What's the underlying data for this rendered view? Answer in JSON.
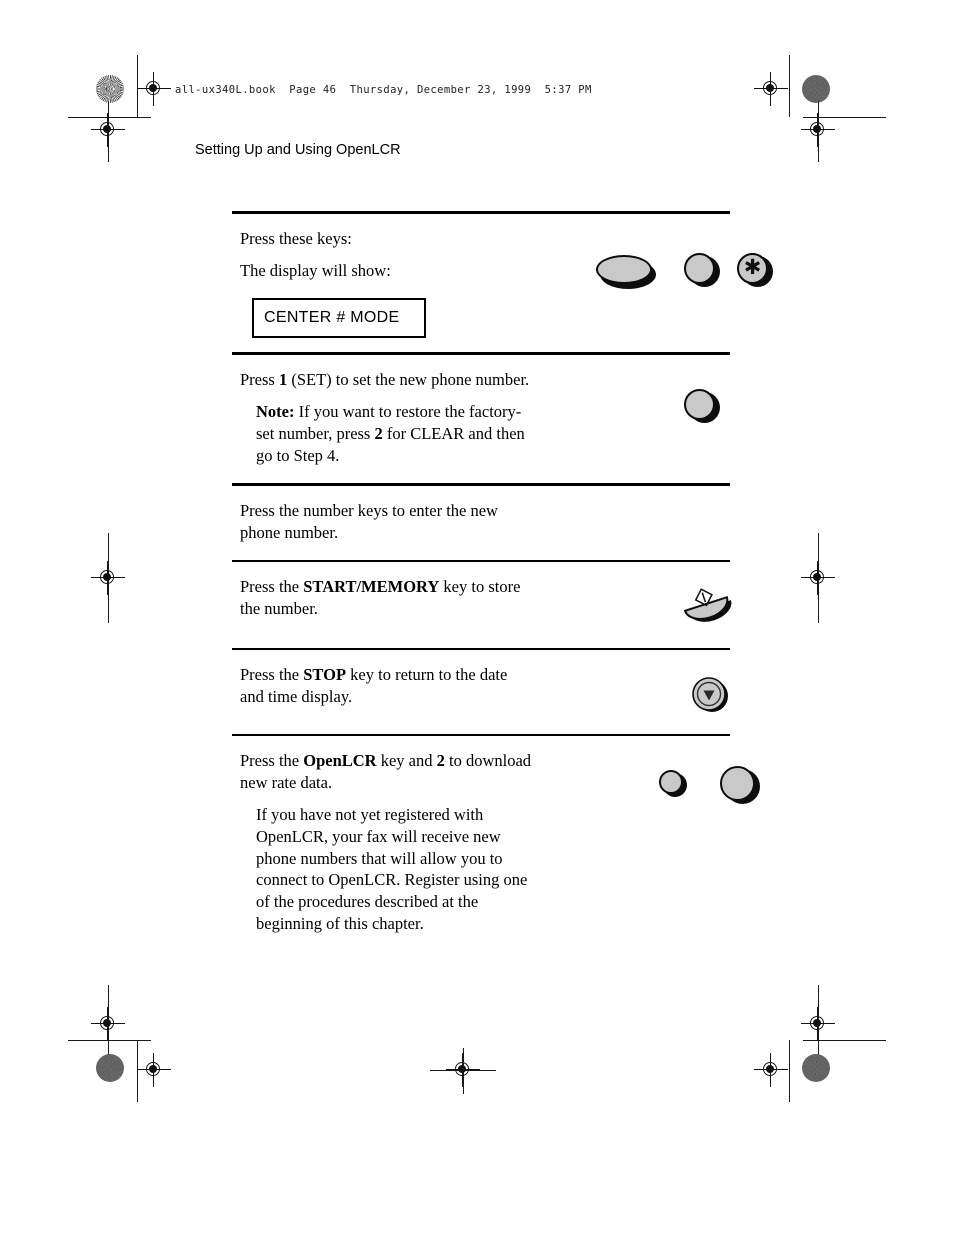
{
  "page": {
    "file_stamp": "all-ux340L.book  Page 46  Thursday, December 23, 1999  5:37 PM",
    "running_head": "Setting Up and Using OpenLCR"
  },
  "steps": [
    {
      "id": "step-center-number-mode",
      "line1": "Press these keys:",
      "line2": "The display will show:",
      "display_value": "CENTER # MODE",
      "keys": [
        "function-oval-key",
        "round-key",
        "asterisk-key"
      ]
    },
    {
      "id": "step-press-1-set",
      "body_prefix": "Press ",
      "body_bold": "1",
      "body_suffix": " (SET) to set the new phone number.",
      "note_label": "Note:",
      "note_part1": " If you want to restore the factory-set number, press ",
      "note_bold": "2",
      "note_part2": " for CLEAR and then go to Step 4.",
      "keys": [
        "round-key"
      ]
    },
    {
      "id": "step-enter-number",
      "body": "Press the number keys to enter the new phone number.",
      "keys": []
    },
    {
      "id": "step-start-memory",
      "body_prefix": "Press the ",
      "body_bold": "START/MEMORY",
      "body_suffix": " key to store the number.",
      "keys": [
        "start-memory-key"
      ]
    },
    {
      "id": "step-stop",
      "body_prefix": "Press the ",
      "body_bold": "STOP",
      "body_suffix": " key to return to the date and time display.",
      "keys": [
        "stop-key"
      ]
    },
    {
      "id": "step-openlcr-download",
      "body_prefix": "Press the ",
      "body_bold": "OpenLCR",
      "body_mid": " key and ",
      "body_bold2": "2",
      "body_suffix": " to download new rate data.",
      "note": "If you have not yet registered with OpenLCR, your fax will receive new phone numbers that will allow you to connect to OpenLCR. Register using one of the procedures described at the beginning of this chapter.",
      "keys": [
        "small-round-key",
        "large-round-key"
      ]
    }
  ],
  "colors": {
    "key_face": "#c9c9c9",
    "key_outline": "#0d0d0d",
    "rule": "#000000",
    "text": "#000000"
  }
}
